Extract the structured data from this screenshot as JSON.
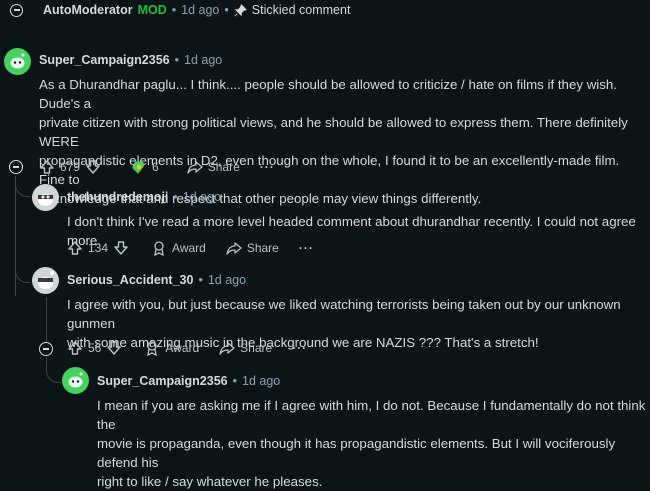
{
  "top_comment": {
    "author": "AutoModerator",
    "mod_badge": "MOD",
    "time": "1d ago",
    "stickied": "Stickied comment"
  },
  "comments": [
    {
      "author": "Super_Campaign2356",
      "time": "1d ago",
      "lines": [
        "As a Dhurandhar paglu... I think.... people should be allowed to criticize / hate on films if they wish. Dude's a",
        "private citizen with strong political views, and he should be allowed to express them. There definitely WERE",
        "propagandistic elements in D2, even though on the whole, I found it to be an excellently-made film. Fine to",
        "acknowledge that and respect that other people may view things differently."
      ],
      "votes": "679",
      "award_count": "6",
      "share": "Share",
      "more": "···"
    },
    {
      "author": "thehundredemoji",
      "time": "1d ago",
      "lines": [
        "I don't think I've read a more level headed comment about dhurandhar recently. I could not agree more."
      ],
      "votes": "134",
      "award": "Award",
      "share": "Share",
      "more": "···"
    },
    {
      "author": "Serious_Accident_30",
      "time": "1d ago",
      "lines": [
        "I agree with you, but just because we liked watching terrorists being taken out by our unknown gunmen",
        "with some amazing music in the background we are NAZIS ??? That's a stretch!"
      ],
      "votes": "56",
      "award": "Award",
      "share": "Share",
      "more": "···"
    },
    {
      "author": "Super_Campaign2356",
      "time": "1d ago",
      "lines": [
        "I mean if you are asking me if I agree with him, I do not. Because I fundamentally do not think the",
        "movie is propaganda, even though it has propagandistic elements. But I will vociferously defend his",
        "right to like / say whatever he pleases."
      ]
    }
  ],
  "separator": "•",
  "icons": [
    "pin-icon",
    "upvote-icon",
    "downvote-icon",
    "award-icon",
    "share-icon",
    "collapse-icon",
    "snoo-avatar-icon"
  ],
  "colors": {
    "background": "#0b1416",
    "mod_green": "#1dbf3a",
    "meta": "#8ba2ad",
    "avatar_green": "#46d160"
  }
}
